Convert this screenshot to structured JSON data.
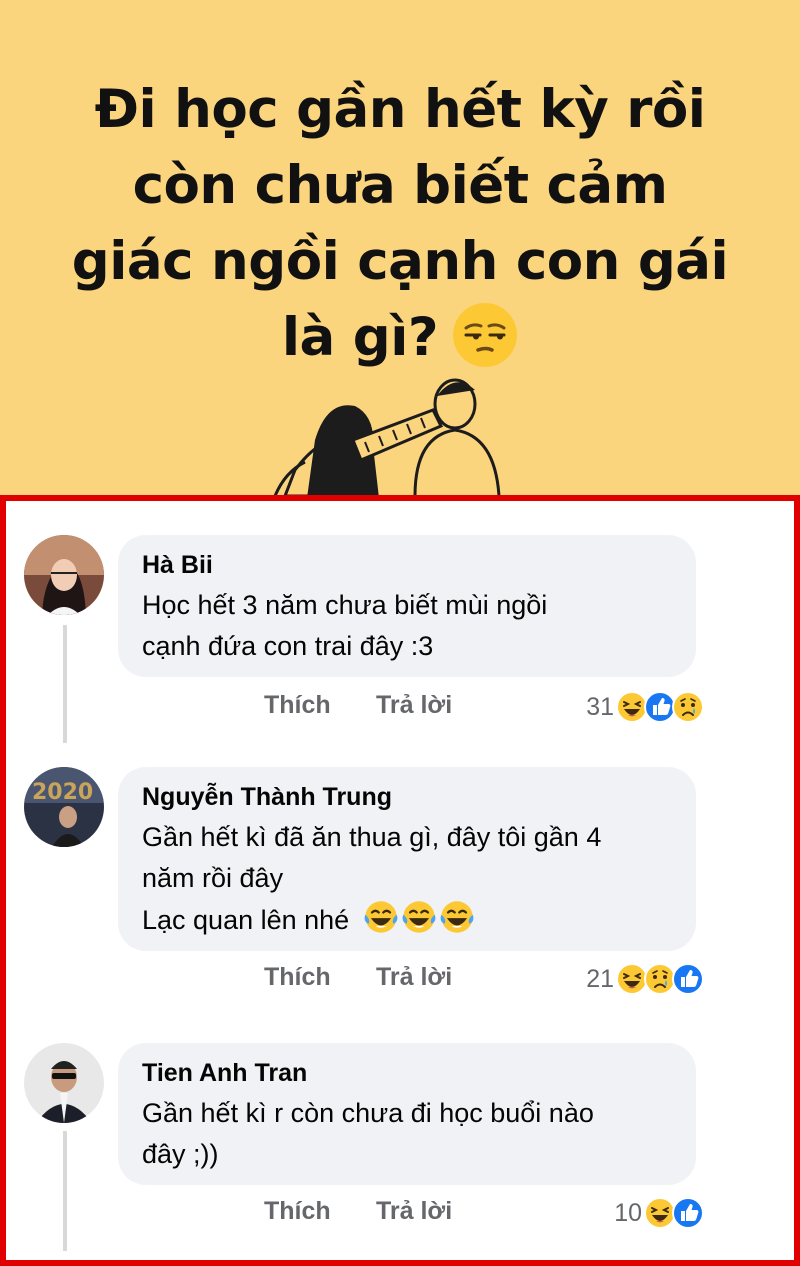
{
  "post": {
    "headline_lines": [
      "Đi học gần hết kỳ rồi",
      "còn chưa biết cảm",
      "giác ngồi cạnh con gái",
      "là gì?"
    ],
    "headline_emoji": "unamused-face-icon",
    "banner_color": "#fbd47e",
    "highlight_color": "#e00000"
  },
  "comments": [
    {
      "author": "Hà Bii",
      "lines": [
        "Học hết 3 năm chưa biết mùi ngồi",
        "cạnh đứa con trai đây :3"
      ],
      "like_label": "Thích",
      "reply_label": "Trả lời",
      "reaction_count": "31",
      "reactions": [
        "haha-icon",
        "like-icon",
        "sad-icon"
      ]
    },
    {
      "author": "Nguyễn Thành Trung",
      "lines": [
        "Gần hết kì đã ăn thua gì, đây tôi gần 4",
        "năm rồi đây",
        "Lạc quan lên nhé"
      ],
      "line_emojis": [
        "tears-of-joy-icon",
        "tears-of-joy-icon",
        "tears-of-joy-icon"
      ],
      "like_label": "Thích",
      "reply_label": "Trả lời",
      "reaction_count": "21",
      "reactions": [
        "haha-icon",
        "sad-icon",
        "like-icon"
      ]
    },
    {
      "author": "Tien Anh Tran",
      "lines": [
        "Gần hết kì r còn chưa đi học buổi nào",
        "đây ;))"
      ],
      "like_label": "Thích",
      "reply_label": "Trả lời",
      "reaction_count": "10",
      "reactions": [
        "haha-icon",
        "like-icon"
      ]
    }
  ]
}
